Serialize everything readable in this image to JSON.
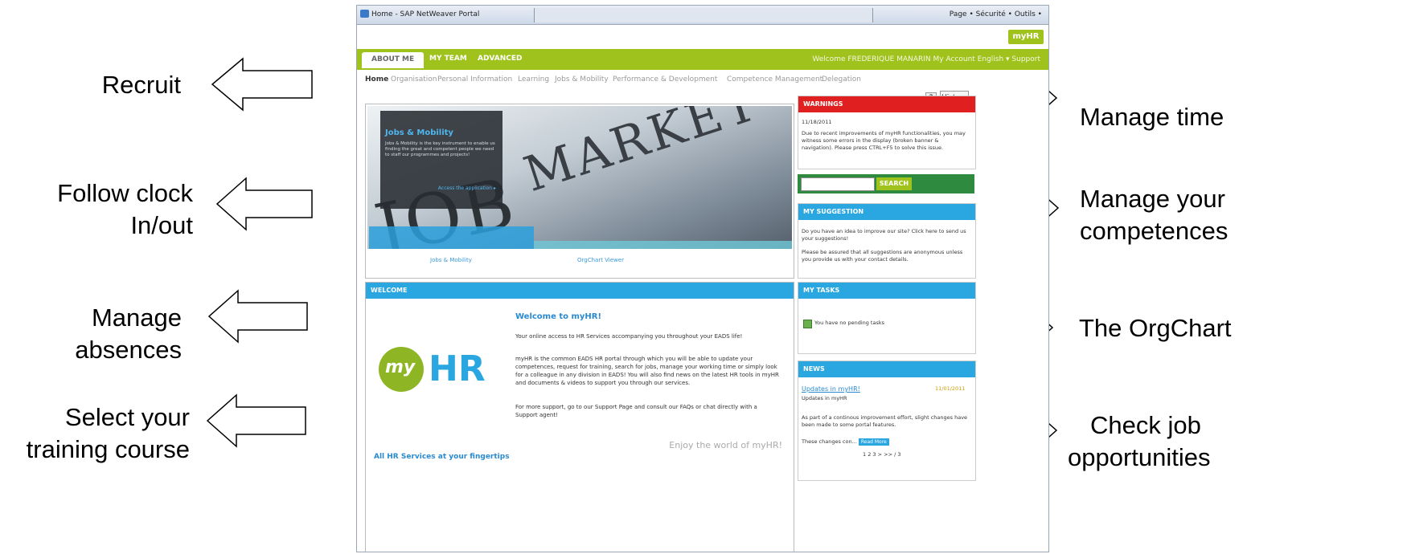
{
  "callouts": {
    "left": [
      "Recruit",
      "Follow clock In/out",
      "Manage absences",
      "Select your training course"
    ],
    "right": [
      "Manage time",
      "Manage your competences",
      "The OrgChart",
      "Check job opportunities"
    ],
    "follow_line1": "Follow clock",
    "follow_line2": "In/out",
    "absences_line1": "Manage",
    "absences_line2": "absences",
    "training_line1": "Select your",
    "training_line2": "training course",
    "competences_line1": "Manage your",
    "competences_line2": "competences",
    "jobs_line1": "Check job",
    "jobs_line2": "opportunities"
  },
  "browser": {
    "title": "Home - SAP NetWeaver Portal",
    "tools": "Page •  Sécurité •  Outils •"
  },
  "header": {
    "badge": "myHR",
    "tabs": [
      "ABOUT ME",
      "MY TEAM",
      "ADVANCED"
    ],
    "welcome": "Welcome FREDERIQUE MANARIN   My Account   English ▾   Support"
  },
  "subnav": [
    "Home",
    "Organisation",
    "Personal Information",
    "Learning",
    "Jobs & Mobility",
    "Performance & Development",
    "Competence Management",
    "Delegation"
  ],
  "toolbar": {
    "help": "?",
    "history": "History"
  },
  "hero": {
    "overlay_title": "Jobs & Mobility",
    "overlay_body": "Jobs & Mobility is the key instrument to enable us finding the great and competent people we need to staff our programmes and projects!",
    "overlay_link": "Access the application ▸",
    "link_left": "Jobs & Mobility",
    "link_right": "OrgChart Viewer",
    "word1": "JOB",
    "word2": "MARKET"
  },
  "welcome": {
    "header": "WELCOME",
    "title": "Welcome to myHR!",
    "p1": "Your online access to HR Services accompanying you throughout your EADS life!",
    "p2": "myHR is the common EADS HR portal through which you will be able to update your competences, request for training, search for jobs, manage your working time or simply look for a colleague in any division in EADS! You will also find news on the latest HR tools in myHR and documents & videos to support you through our services.",
    "p3": "For more support, go to our Support Page and consult our FAQs or chat directly with a Support agent!",
    "enjoy": "Enjoy the world of myHR!",
    "logo_my": "my",
    "logo_hr": "HR",
    "tagline": "All HR Services at your fingertips"
  },
  "warnings": {
    "header": "WARNINGS",
    "date": "11/18/2011",
    "text": "Due to recent improvements of myHR functionalities, you may witness some errors in the display (broken banner & navigation). Please press CTRL+F5 to solve this issue."
  },
  "search": {
    "button": "SEARCH"
  },
  "suggestion": {
    "header": "MY SUGGESTION",
    "p1": "Do you have an idea to improve our site? Click here to send us your suggestions!",
    "p2": "Please be assured that all suggestions are anonymous unless you provide us with your contact details."
  },
  "tasks": {
    "header": "MY TASKS",
    "text": "You have no pending tasks"
  },
  "news": {
    "header": "NEWS",
    "item_title": "Updates in myHR!",
    "item_date": "11/01/2011",
    "item_sub": "Updates in myHR",
    "item_body": "As part of a continous improvement effort, slight changes have been made to some portal features.",
    "teaser": "These changes con...",
    "read_more": "Read More",
    "pager": "1 2 3 > >>  / 3"
  },
  "colors": {
    "accent_green": "#9fc21c",
    "accent_blue": "#2aa6e0",
    "warning_red": "#e02020",
    "search_green": "#2e8a3e"
  }
}
